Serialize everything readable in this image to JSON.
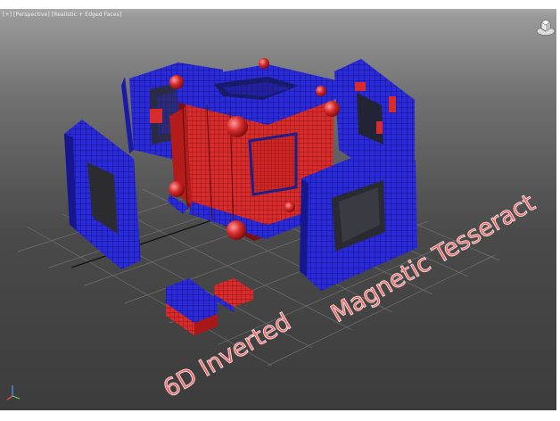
{
  "viewport": {
    "labels": [
      {
        "text": "[+]"
      },
      {
        "text": "[Perspective]"
      },
      {
        "text": "[Realistic + Edged Faces]"
      }
    ]
  },
  "scene": {
    "title_line1": "6D Inverted",
    "title_line2": "Magnetic Tesseract"
  },
  "icons": {
    "viewcube": "viewcube-home-icon",
    "axis": "xyz-axis-tripod-icon"
  },
  "colors": {
    "blue": "#2323d8",
    "red": "#d82b2b",
    "title_fill": "#ef6161",
    "background_top": "#b9b9b9",
    "background_bottom": "#3b3b3b"
  }
}
